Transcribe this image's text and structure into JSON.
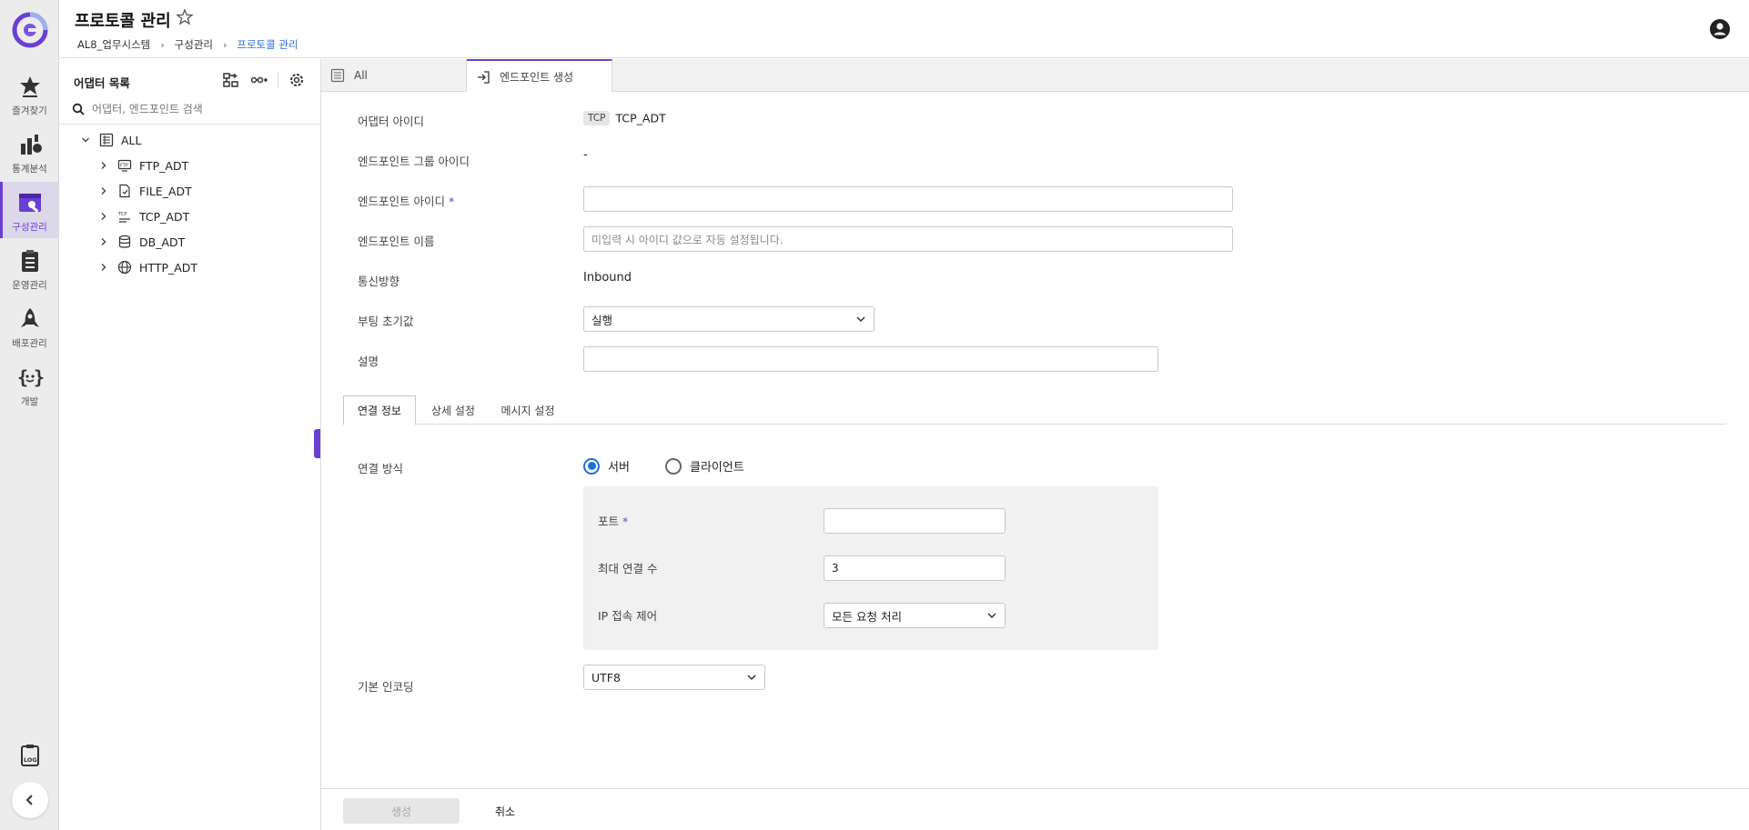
{
  "header": {
    "title": "프로토콜 관리",
    "breadcrumb": [
      "AL8_업무시스템",
      "구성관리",
      "프로토콜 관리"
    ]
  },
  "rail": {
    "items": [
      {
        "label": "즐겨찾기",
        "icon": "star-icon"
      },
      {
        "label": "통계분석",
        "icon": "chart-icon"
      },
      {
        "label": "구성관리",
        "icon": "config-icon",
        "active": true
      },
      {
        "label": "운영관리",
        "icon": "clipboard-icon"
      },
      {
        "label": "배포관리",
        "icon": "rocket-icon"
      },
      {
        "label": "개발",
        "icon": "code-icon"
      }
    ]
  },
  "tree_panel": {
    "title": "어댑터 목록",
    "search_placeholder": "어댑터, 엔드포인트 검색",
    "root": "ALL",
    "nodes": [
      "FTP_ADT",
      "FILE_ADT",
      "TCP_ADT",
      "DB_ADT",
      "HTTP_ADT"
    ]
  },
  "tabs": [
    {
      "label": "All",
      "active": false
    },
    {
      "label": "엔드포인트 생성",
      "active": true
    }
  ],
  "form": {
    "adapter_id_label": "어댑터 아이디",
    "adapter_chip": "TCP",
    "adapter_id_value": "TCP_ADT",
    "group_id_label": "엔드포인트 그룹 아이디",
    "group_id_value": "-",
    "endpoint_id_label": "엔드포인트 아이디",
    "endpoint_id_value": "",
    "endpoint_name_label": "엔드포인트 이름",
    "endpoint_name_placeholder": "미입력 시 아이디 값으로 자동 설정됩니다.",
    "direction_label": "통신방향",
    "direction_value": "Inbound",
    "boot_label": "부팅 초기값",
    "boot_value": "실행",
    "desc_label": "설명",
    "desc_value": ""
  },
  "subtabs": [
    "연결 정보",
    "상세 설정",
    "메시지 설정"
  ],
  "connection": {
    "method_label": "연결 방식",
    "options": [
      "서버",
      "클라이언트"
    ],
    "selected": "서버",
    "port_label": "포트",
    "port_value": "",
    "max_conn_label": "최대 연결 수",
    "max_conn_value": "3",
    "ip_label": "IP 접속 제어",
    "ip_value": "모든 요청 처리",
    "encoding_label": "기본 인코딩",
    "encoding_value": "UTF8"
  },
  "footer": {
    "create_label": "생성",
    "cancel_label": "취소"
  },
  "colors": {
    "accent": "#6a3fd3",
    "link": "#2b6fd6",
    "radio": "#1f6fd6"
  }
}
